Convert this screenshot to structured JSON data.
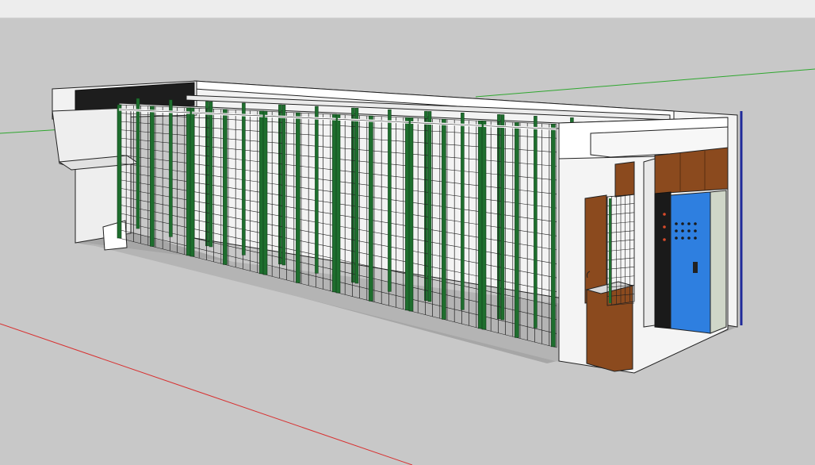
{
  "window": {
    "toolbar_strip": ""
  },
  "scene": {
    "model": "container-vertical-farm",
    "colors": {
      "background": "#c8c8c8",
      "ground_shadow": "#a6a6a6",
      "wall_white": "#f4f4f4",
      "frame_green": "#1e6e2e",
      "mesh_dark": "#202020",
      "wood": "#8b4a1e",
      "door_blue": "#2e7fe0",
      "axis_red": "#d83030",
      "axis_green": "#2fa72f",
      "axis_blue": "#1f2a9a"
    },
    "axes": [
      "red-axis",
      "green-axis",
      "blue-axis"
    ],
    "rack_modules": 6,
    "electrical_panel": {
      "indicator_rows": 3,
      "indicator_cols": 4
    }
  }
}
